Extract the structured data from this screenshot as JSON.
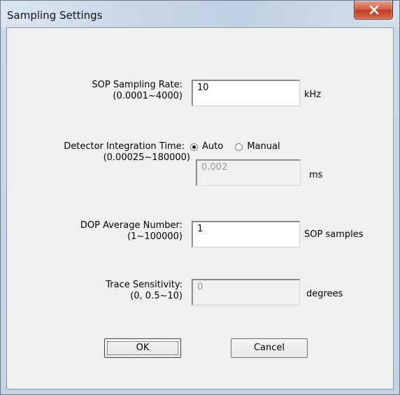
{
  "window": {
    "title": "Sampling Settings"
  },
  "fields": {
    "sop_rate": {
      "label": "SOP Sampling Rate:",
      "range": "(0.0001~4000)",
      "value": "10",
      "unit": "kHz"
    },
    "integration": {
      "label": "Detector Integration Time:",
      "range": "(0.00025~180000)",
      "value": "0.002",
      "unit": "ms",
      "mode_auto": "Auto",
      "mode_manual": "Manual",
      "selected_mode": "Auto"
    },
    "dop_avg": {
      "label": "DOP Average Number:",
      "range": "(1~100000)",
      "value": "1",
      "unit": "SOP samples"
    },
    "trace": {
      "label": "Trace Sensitivity:",
      "range": "(0, 0.5~10)",
      "value": "0",
      "unit": "degrees"
    }
  },
  "buttons": {
    "ok": "OK",
    "cancel": "Cancel"
  },
  "icons": {
    "close": "close-icon"
  }
}
